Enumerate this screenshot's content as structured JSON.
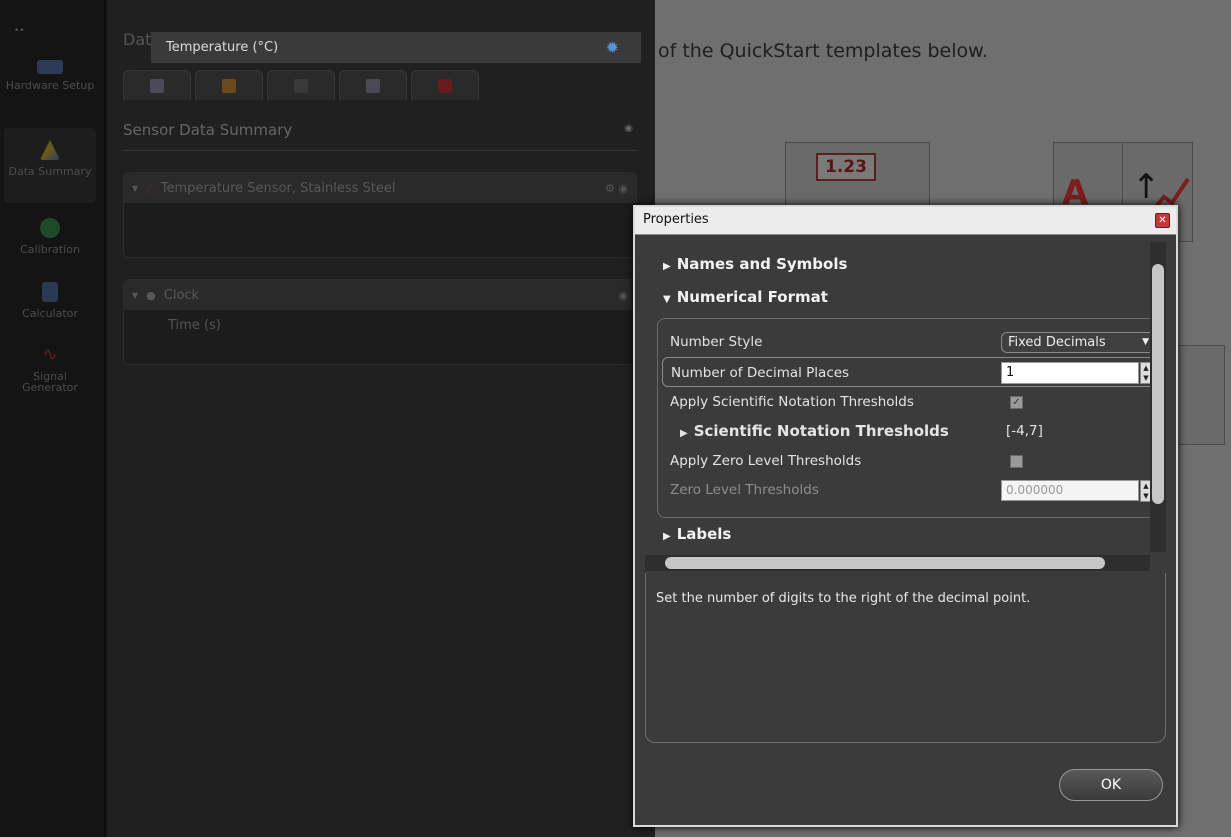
{
  "workspace": {
    "quickstart_text": "of the QuickStart templates below.",
    "digits_sample": "1.23"
  },
  "rail": {
    "items": [
      {
        "label": "Hardware Setup",
        "icon": "hardware-setup-icon"
      },
      {
        "label": "Data Summary",
        "icon": "data-summary-icon"
      },
      {
        "label": "Calibration",
        "icon": "calibration-icon"
      },
      {
        "label": "Calculator",
        "icon": "calculator-icon"
      },
      {
        "label": "Signal Generator",
        "icon": "signal-generator-icon"
      }
    ]
  },
  "panel": {
    "title": "Data Summary",
    "section_title": "Sensor Data Summary",
    "groups": [
      {
        "name": "Temperature Sensor, Stainless Steel",
        "measurement": "Temperature (°C)"
      },
      {
        "name": "Clock",
        "measurement": "Time (s)"
      }
    ]
  },
  "dialog": {
    "title": "Properties",
    "categories": {
      "names": "Names and Symbols",
      "numerical": "Numerical Format",
      "labels": "Labels"
    },
    "rows": {
      "number_style": {
        "label": "Number Style",
        "value": "Fixed Decimals"
      },
      "decimal_places": {
        "label": "Number of Decimal Places",
        "value": "1"
      },
      "apply_sci": {
        "label": "Apply Scientific Notation Thresholds",
        "checked": true
      },
      "sci_thresholds": {
        "label": "Scientific Notation Thresholds",
        "value": "[-4,7]"
      },
      "apply_zero": {
        "label": "Apply Zero Level Thresholds",
        "checked": false
      },
      "zero_thresholds": {
        "label": "Zero Level Thresholds",
        "value": "0.000000"
      }
    },
    "description": "Set the number of digits to the right of the decimal point.",
    "ok_label": "OK"
  }
}
